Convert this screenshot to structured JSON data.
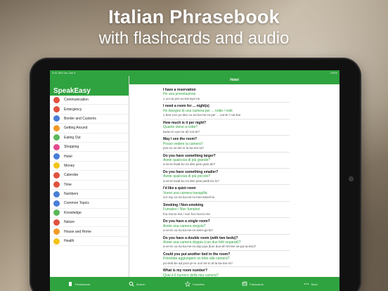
{
  "headline": {
    "line1": "Italian Phrasebook",
    "line2": "with flashcards and audio"
  },
  "statusbar": {
    "left": "9:41 AM   Tue Jan 9",
    "center": "...",
    "right": "100%"
  },
  "app": {
    "title": "SpeakEasy",
    "section_title": "Hotel",
    "accent": "#2fa33f"
  },
  "categories": [
    {
      "label": "Communication",
      "color": "#e0523f"
    },
    {
      "label": "Emergency",
      "color": "#e0523f"
    },
    {
      "label": "Border and Customs",
      "color": "#4a7fd6"
    },
    {
      "label": "Getting Around",
      "color": "#f29a28"
    },
    {
      "label": "Eating Out",
      "color": "#5cb85c"
    },
    {
      "label": "Shopping",
      "color": "#e44b8d"
    },
    {
      "label": "Hotel",
      "color": "#4a7fd6"
    },
    {
      "label": "Money",
      "color": "#f2c418"
    },
    {
      "label": "Calendar",
      "color": "#e0523f"
    },
    {
      "label": "Time",
      "color": "#e0523f"
    },
    {
      "label": "Numbers",
      "color": "#4a7fd6"
    },
    {
      "label": "Common Topics",
      "color": "#4a7fd6"
    },
    {
      "label": "Knowledge",
      "color": "#5cb85c"
    },
    {
      "label": "Nature",
      "color": "#e0523f"
    },
    {
      "label": "House and Home",
      "color": "#f29a28"
    },
    {
      "label": "Health",
      "color": "#f2c418"
    }
  ],
  "phrases": [
    {
      "en": "I have a reservation",
      "it": "Ho una prenotazione",
      "pr": "o oo-na pre-no-tat-tsye-ne"
    },
    {
      "en": "I need a room for ... night(s)",
      "it": "Ho bisogno di una camera per ... notte / notti",
      "pr": "o bee-zon-yo dee oo-na ka-me-ra per ... not-te / not-tee"
    },
    {
      "en": "How much is it per night?",
      "it": "Quanto viene a notte?",
      "pr": "kwan-to vye-ne ah not-te?"
    },
    {
      "en": "May I see the room?",
      "it": "Posso vedere la camera?",
      "pr": "pos-so ve-de-re la ka-me-ra?"
    },
    {
      "en": "Do you have something larger?",
      "it": "Avete qualcosa di più grande?",
      "pr": "a-ve-te kwal-ko-za dee pew gran-de?"
    },
    {
      "en": "Do you have something smaller?",
      "it": "Avete qualcosa di più piccolo?",
      "pr": "a-ve-te kwal-ko-za dee pew peek-ko-lo?"
    },
    {
      "en": "I'd like a quiet room",
      "it": "Vorrei una camera tranquilla",
      "pr": "vor-ray oo-na ka-me-ra tran-kweel-la"
    },
    {
      "en": "Smoking / Non-smoking",
      "it": "Fumatori / Non fumatori",
      "pr": "foo-ma-to-ree / non foo-ma-to-ree"
    },
    {
      "en": "Do you have a single room?",
      "it": "Avete una camera singola?",
      "pr": "a-ve-te oo-na ka-me-ra seen-go-la?"
    },
    {
      "en": "Do you have a double room (with two beds)?",
      "it": "Avete una camera doppia (con due letti separati)?",
      "pr": "a-ve-te oo-na ka-me-ra dop-pya (kon doo-eh let-tee se-pa-ra-tee)?"
    },
    {
      "en": "Could you put another bed in the room?",
      "it": "Potrebbe aggiungere un letto alla camera?",
      "pr": "po-treb-be ad-joon-je-re oon let-to al-la ka-me-ra?"
    },
    {
      "en": "What is my room number?",
      "it": "Qual è il numero della mia camera?",
      "pr": ""
    }
  ],
  "tabs": [
    {
      "label": "Phrasebook",
      "icon": "book-icon"
    },
    {
      "label": "Search",
      "icon": "search-icon"
    },
    {
      "label": "Favorites",
      "icon": "star-icon"
    },
    {
      "label": "Flashcards",
      "icon": "cards-icon"
    },
    {
      "label": "More",
      "icon": "more-icon"
    }
  ]
}
